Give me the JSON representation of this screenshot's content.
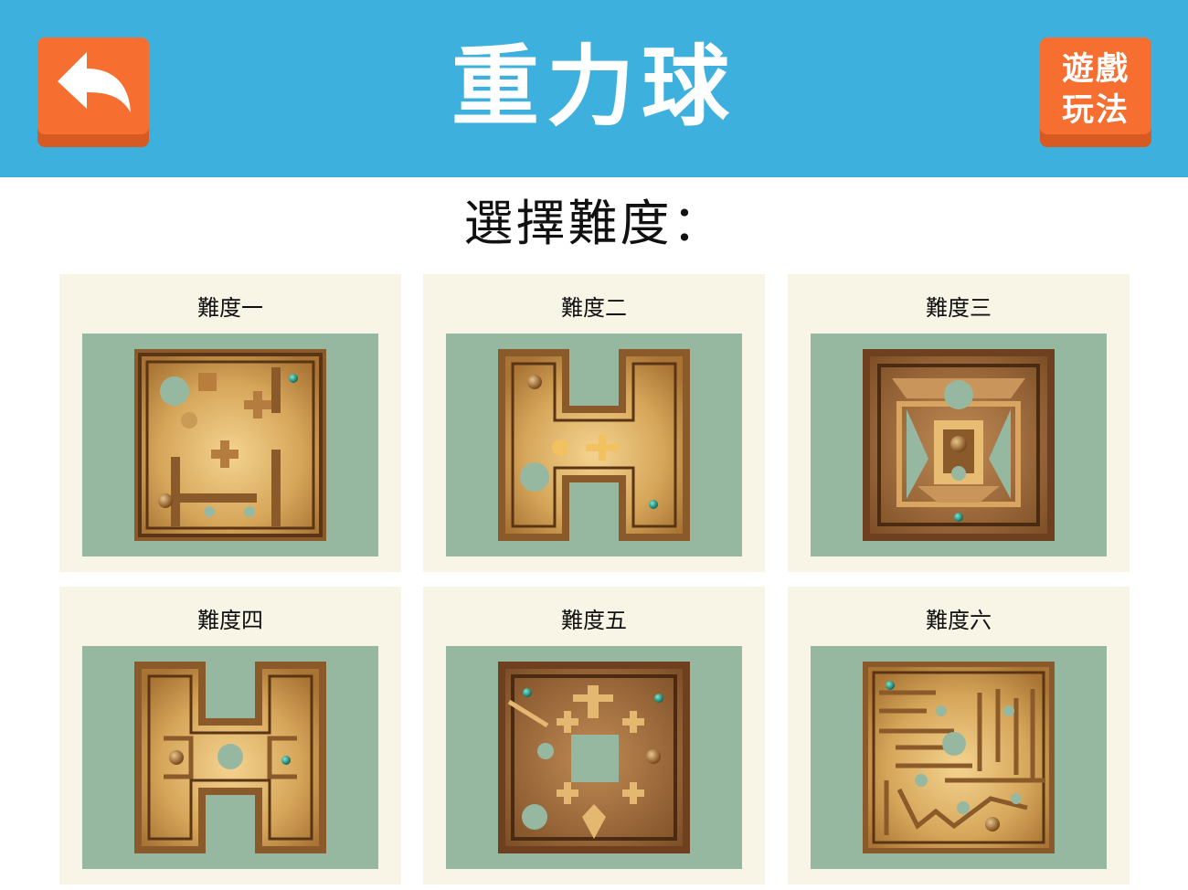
{
  "header": {
    "title": "重力球",
    "help_line1": "遊戲",
    "help_line2": "玩法",
    "back_icon": "undo-arrow-icon"
  },
  "subtitle": "選擇難度：",
  "levels": [
    {
      "label": "難度一"
    },
    {
      "label": "難度二"
    },
    {
      "label": "難度三"
    },
    {
      "label": "難度四"
    },
    {
      "label": "難度五"
    },
    {
      "label": "難度六"
    }
  ],
  "colors": {
    "header_bg": "#3eb0de",
    "button_orange": "#f66e30",
    "card_bg": "#f8f5e7",
    "preview_bg": "#97b8a0",
    "wood_light": "#d9ad62",
    "wood_dark": "#7a4d22",
    "goal_ball": "#1f9c8a"
  }
}
